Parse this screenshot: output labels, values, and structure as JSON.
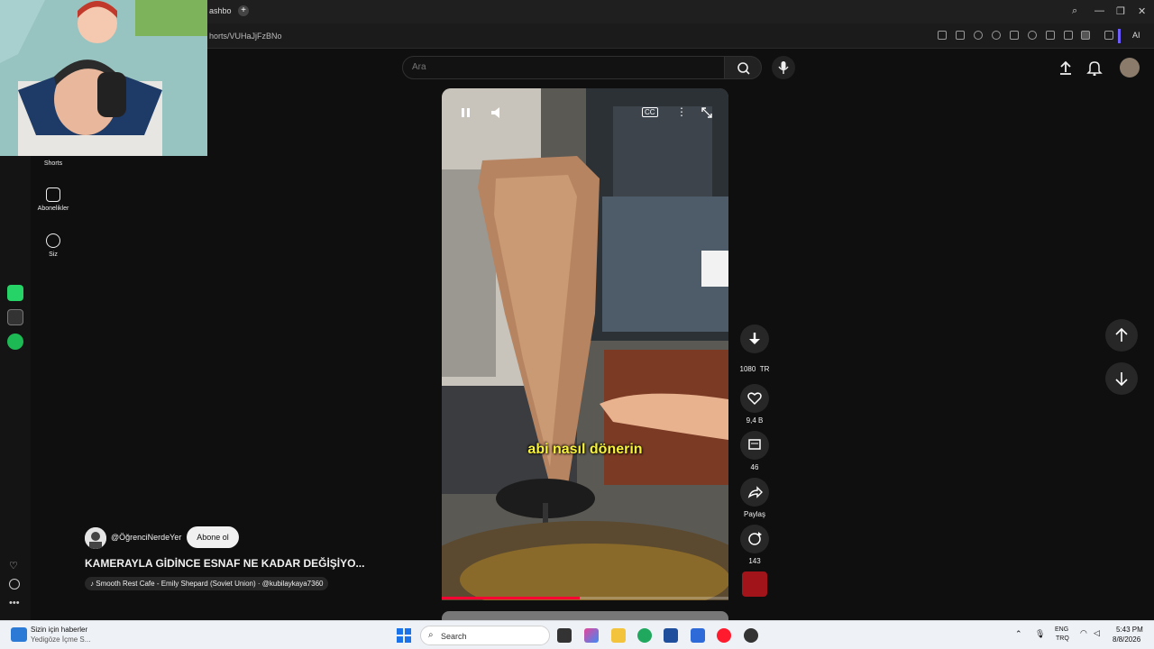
{
  "browser": {
    "tab_text": "ashbo",
    "new_tab": "+",
    "url": "horts/VUHaJjFzBNo",
    "ai_label": "AI",
    "window": {
      "search": "⌕",
      "minimize": "—",
      "restore": "❐",
      "close": "✕"
    }
  },
  "youtube": {
    "search_placeholder": "Ara",
    "rail": [
      {
        "label": "Shorts"
      },
      {
        "label": "Abonelikler"
      },
      {
        "label": "Siz"
      }
    ],
    "video": {
      "caption": "abi nasıl dönerin",
      "cc_label": "CC",
      "progress_fraction": 0.48
    },
    "actions": {
      "quality": "1080",
      "quality_suffix": "TR",
      "likes": "9,4 B",
      "comments": "46",
      "share": "Paylaş",
      "remix": "143"
    },
    "channel": {
      "handle": "@ÖğrenciNerdeYer",
      "subscribe": "Abone ol"
    },
    "title": "KAMERAYLA GİDİNCE ESNAF NE KADAR DEĞİŞİYO...",
    "music": "Smooth Rest Cafe - Emily Shepard (Soviet Union) · @kubilaykaya7360"
  },
  "taskbar": {
    "news_title": "Sizin için haberler",
    "news_sub": "Yedigöze İçme S...",
    "search": "Search",
    "lang1": "ENG",
    "lang2": "TRQ",
    "time": "5:43 PM",
    "date": "8/8/2026"
  },
  "colors": {
    "yt_bg": "#0f0f0f",
    "progress": "#ff0033",
    "caption": "#f7f23a"
  }
}
